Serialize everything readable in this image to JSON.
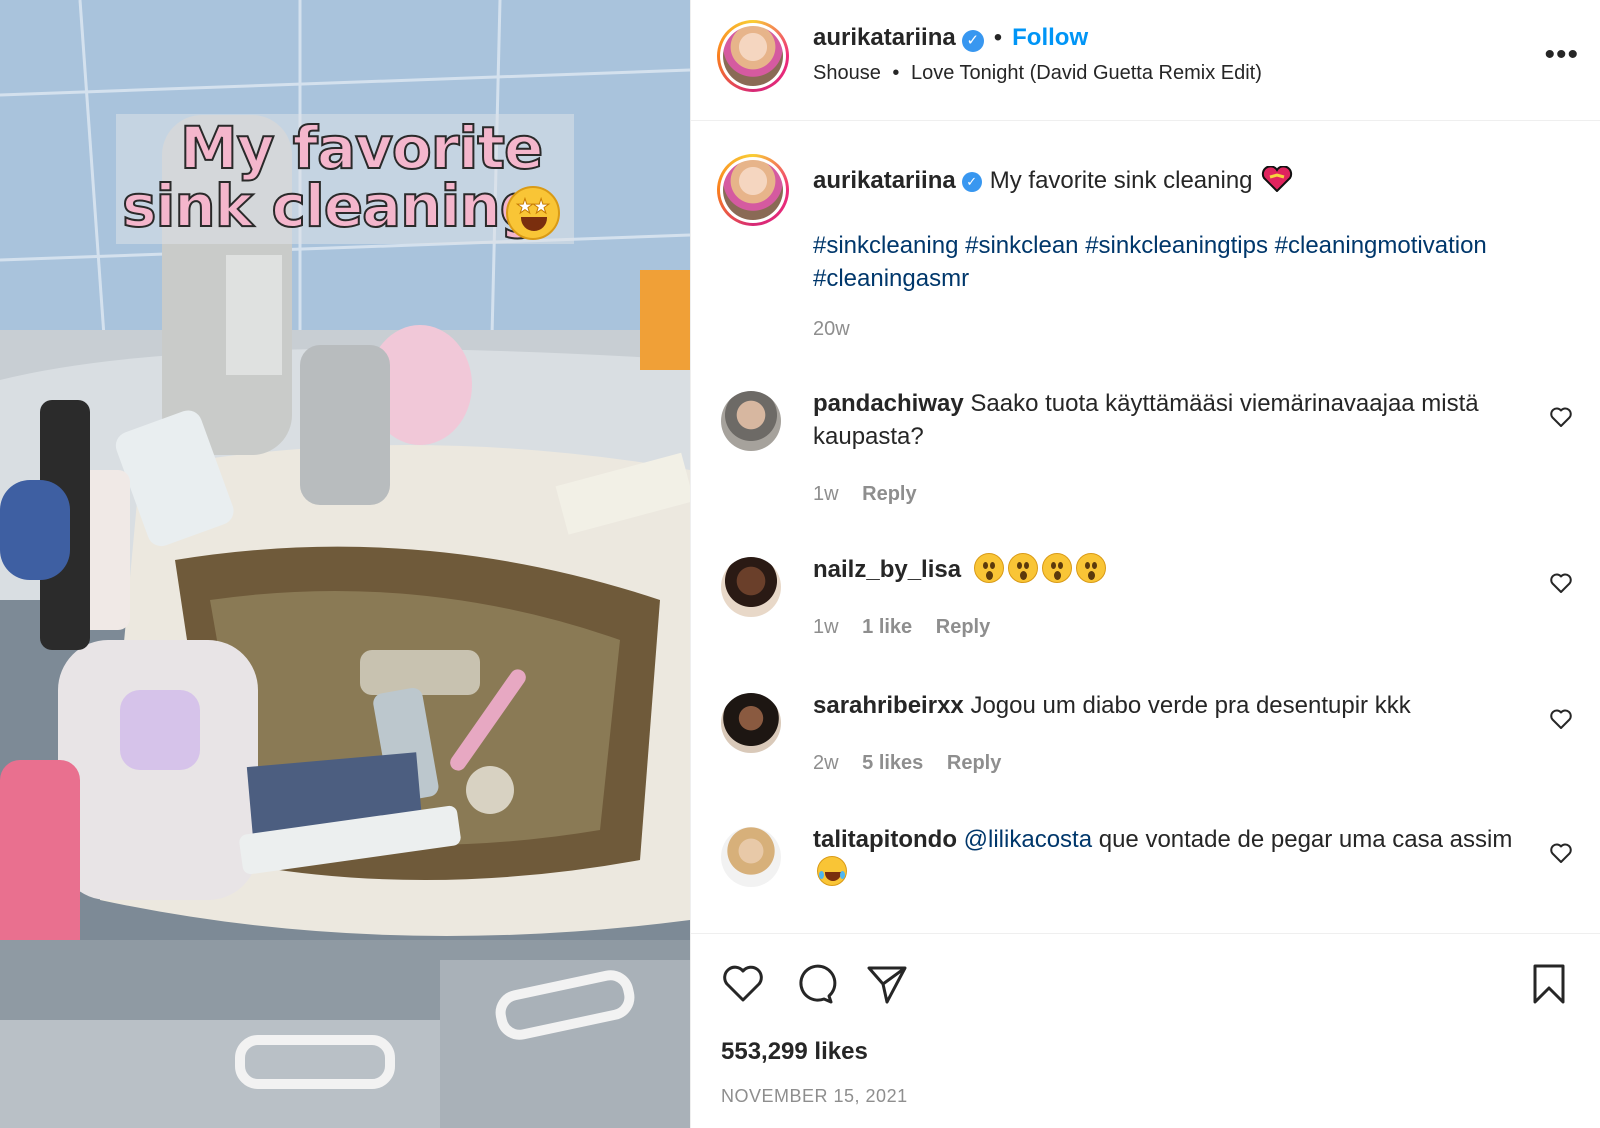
{
  "media": {
    "overlay_line1": "My favorite",
    "overlay_line2": "sink cleaning",
    "overlay_emoji": "star-struck-emoji"
  },
  "header": {
    "username": "aurikatariina",
    "verified": true,
    "separator": "•",
    "follow_label": "Follow",
    "audio_artist": "Shouse",
    "audio_separator": "•",
    "audio_track": "Love Tonight (David Guetta Remix Edit)",
    "more_icon": "more-options-icon"
  },
  "caption": {
    "username": "aurikatariina",
    "text": "My favorite sink cleaning",
    "hashtags": [
      "#sinkcleaning",
      "#sinkclean",
      "#sinkcleaningtips",
      "#cleaningmotivation",
      "#cleaningasmr"
    ],
    "time": "20w"
  },
  "comments": [
    {
      "username": "pandachiway",
      "text": "Saako tuota käyttämääsi viemärinavaajaa mistä kaupasta?",
      "time": "1w",
      "likes": "",
      "reply": "Reply"
    },
    {
      "username": "nailz_by_lisa",
      "text": "",
      "time": "1w",
      "likes": "1 like",
      "reply": "Reply"
    },
    {
      "username": "sarahribeirxx",
      "text": "Jogou um diabo verde pra desentupir kkk",
      "time": "2w",
      "likes": "5 likes",
      "reply": "Reply"
    },
    {
      "username": "talitapitondo",
      "mention": "@lilikacosta",
      "text": " que vontade de pegar uma casa assim",
      "time": "",
      "likes": "",
      "reply": ""
    }
  ],
  "footer": {
    "likes": "553,299 likes",
    "date": "NOVEMBER 15, 2021"
  },
  "colors": {
    "accent": "#0095f6",
    "hashtag": "#00376b",
    "muted": "#8e8e8e",
    "verified": "#3897f0"
  }
}
